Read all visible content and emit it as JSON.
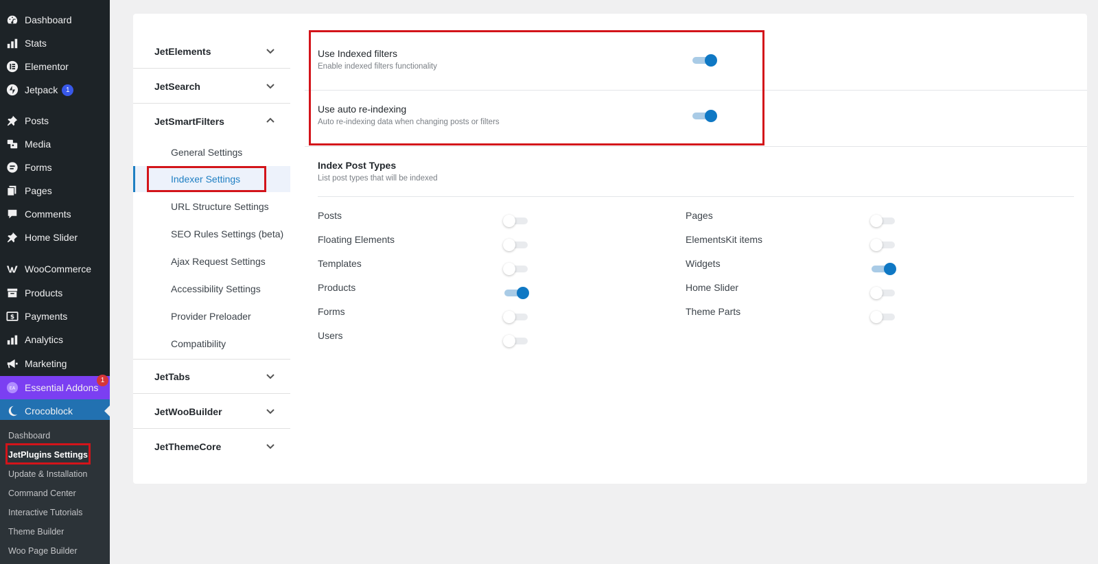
{
  "wp_menu": [
    {
      "label": "Dashboard",
      "icon": "dashboard-icon"
    },
    {
      "label": "Stats",
      "icon": "stats-icon"
    },
    {
      "label": "Elementor",
      "icon": "elementor-icon"
    },
    {
      "label": "Jetpack",
      "icon": "jetpack-icon",
      "badge": "1"
    },
    {
      "label": "Posts",
      "icon": "pin-icon"
    },
    {
      "label": "Media",
      "icon": "media-icon"
    },
    {
      "label": "Forms",
      "icon": "forms-icon"
    },
    {
      "label": "Pages",
      "icon": "pages-icon"
    },
    {
      "label": "Comments",
      "icon": "comments-icon"
    },
    {
      "label": "Home Slider",
      "icon": "pin-icon"
    },
    {
      "label": "WooCommerce",
      "icon": "woocommerce-icon"
    },
    {
      "label": "Products",
      "icon": "products-icon"
    },
    {
      "label": "Payments",
      "icon": "payments-icon"
    },
    {
      "label": "Analytics",
      "icon": "analytics-icon"
    },
    {
      "label": "Marketing",
      "icon": "marketing-icon"
    },
    {
      "label": "Essential Addons",
      "icon": "essential-addons-icon",
      "badge": "1"
    },
    {
      "label": "Crocoblock",
      "icon": "crocoblock-icon"
    }
  ],
  "ea_icon_text": "EA",
  "submenu": [
    {
      "label": "Dashboard"
    },
    {
      "label": "JetPlugins Settings"
    },
    {
      "label": "Update & Installation"
    },
    {
      "label": "Command Center"
    },
    {
      "label": "Interactive Tutorials"
    },
    {
      "label": "Theme Builder"
    },
    {
      "label": "Woo Page Builder"
    }
  ],
  "plugins_nav": {
    "jetelements": "JetElements",
    "jetsearch": "JetSearch",
    "jetsmartfilters": "JetSmartFilters",
    "subs": [
      "General Settings",
      "Indexer Settings",
      "URL Structure Settings",
      "SEO Rules Settings (beta)",
      "Ajax Request Settings",
      "Accessibility Settings",
      "Provider Preloader",
      "Compatibility"
    ],
    "jettabs": "JetTabs",
    "jetwoobuilder": "JetWooBuilder",
    "jetthemecore": "JetThemeCore"
  },
  "settings": {
    "indexed": {
      "title": "Use Indexed filters",
      "desc": "Enable indexed filters functionality",
      "enabled": true
    },
    "reindex": {
      "title": "Use auto re-indexing",
      "desc": "Auto re-indexing data when changing posts or filters",
      "enabled": true
    }
  },
  "index_post_types": {
    "title": "Index Post Types",
    "desc": "List post types that will be indexed",
    "left": [
      {
        "label": "Posts",
        "enabled": false
      },
      {
        "label": "Floating Elements",
        "enabled": false
      },
      {
        "label": "Templates",
        "enabled": false
      },
      {
        "label": "Products",
        "enabled": true
      },
      {
        "label": "Forms",
        "enabled": false
      },
      {
        "label": "Users",
        "enabled": false
      }
    ],
    "right": [
      {
        "label": "Pages",
        "enabled": false
      },
      {
        "label": "ElementsKit items",
        "enabled": false
      },
      {
        "label": "Widgets",
        "enabled": true
      },
      {
        "label": "Home Slider",
        "enabled": false
      },
      {
        "label": "Theme Parts",
        "enabled": false
      }
    ]
  },
  "colors": {
    "accent": "#0f78c4",
    "highlight": "#d3141a",
    "sidebar": "#1d2327"
  }
}
